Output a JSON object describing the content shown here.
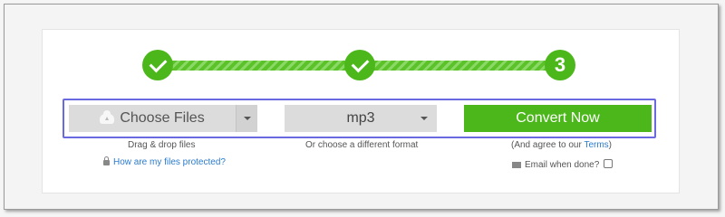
{
  "steps": [
    {
      "label": "",
      "state": "done"
    },
    {
      "label": "",
      "state": "done"
    },
    {
      "label": "3",
      "state": "current"
    }
  ],
  "upload": {
    "choose_label": "Choose Files",
    "drag_hint": "Drag & drop files",
    "protected_link": "How are my files protected?"
  },
  "format": {
    "selected": "mp3",
    "hint": "Or choose a different format"
  },
  "convert": {
    "label": "Convert Now",
    "terms_prefix": "(And agree to our ",
    "terms_link": "Terms",
    "terms_suffix": ")",
    "email_label": "Email when done?"
  },
  "colors": {
    "accent_green": "#4cb71a",
    "link_blue": "#2a7bd0",
    "focus_outline": "#6a6ae0"
  }
}
